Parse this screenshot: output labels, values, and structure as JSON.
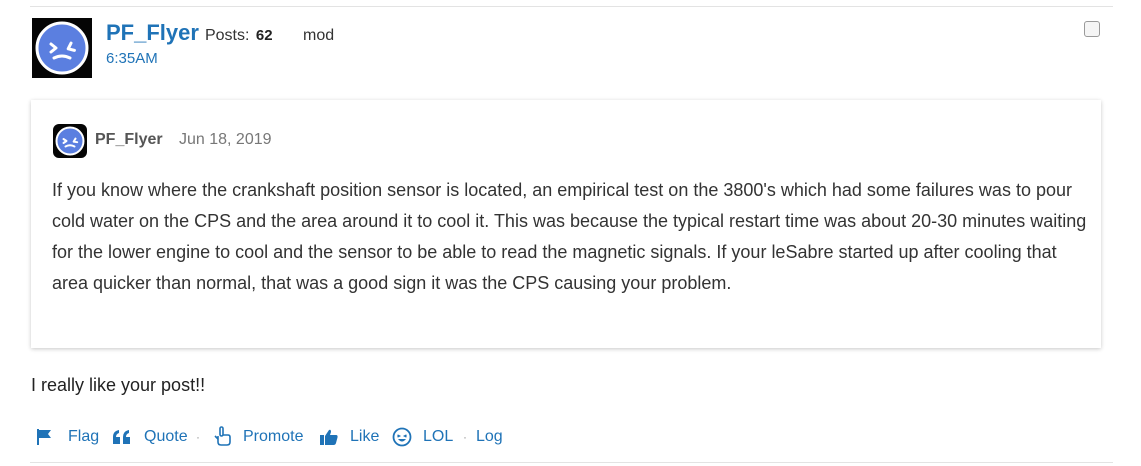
{
  "post": {
    "username": "PF_Flyer",
    "posts_label": "Posts:",
    "posts_count": "62",
    "role": "mod",
    "time": "6:35AM"
  },
  "quote": {
    "author": "PF_Flyer",
    "date": "Jun 18, 2019",
    "body": "If you know where the crankshaft position sensor is located, an empirical test on the 3800's which had some failures was to pour cold water on the CPS and the area around it to cool it. This was because the typical restart time was about 20-30 minutes waiting for the lower engine to cool and the sensor to be able to read the magnetic signals. If your leSabre started up after cooling that area quicker than normal, that was a good sign it was the CPS causing your problem."
  },
  "reply": "I really like your post!!",
  "actions": {
    "flag": "Flag",
    "quote": "Quote",
    "promote": "Promote",
    "like": "Like",
    "lol": "LOL",
    "log": "Log",
    "separator": "·"
  },
  "icons": {
    "flag": "flag-icon",
    "quote": "quote-icon",
    "promote": "pointing-hand-icon",
    "like": "thumbs-up-icon",
    "lol": "laughing-face-icon"
  },
  "colors": {
    "link": "#1f73b7",
    "avatar_face": "#5b7fe0",
    "avatar_bg": "#050505"
  }
}
